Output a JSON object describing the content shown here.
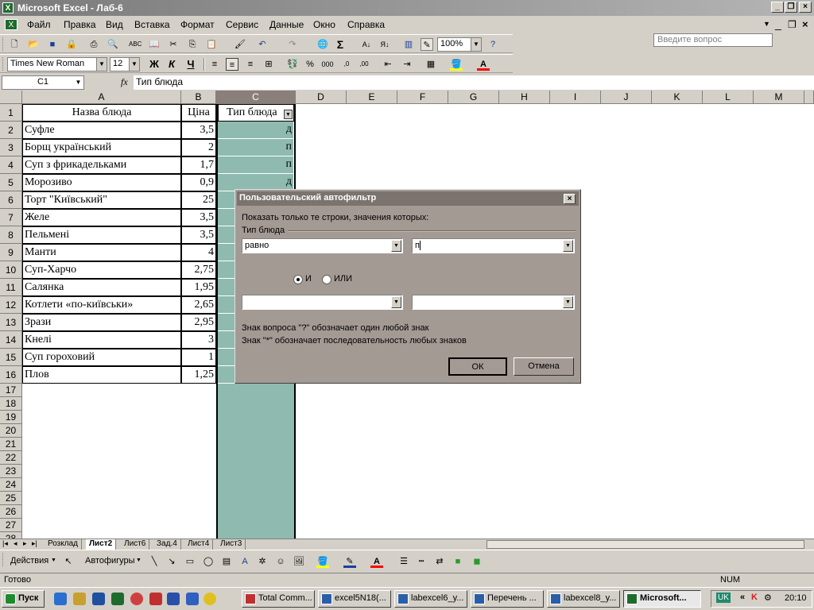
{
  "window": {
    "title": "Microsoft Excel - Лаб-6"
  },
  "menu": {
    "items": [
      "Файл",
      "Правка",
      "Вид",
      "Вставка",
      "Формат",
      "Сервис",
      "Данные",
      "Окно",
      "Справка"
    ],
    "ask_placeholder": "Введите вопрос"
  },
  "toolbar": {
    "zoom": "100%",
    "font": "Times New Roman",
    "font_size": "12",
    "bold": "Ж",
    "italic": "К",
    "underline": "Ч"
  },
  "formula": {
    "namebox": "C1",
    "fx": "fx",
    "content": "Тип блюда"
  },
  "grid": {
    "columns": [
      "A",
      "B",
      "C",
      "D",
      "E",
      "F",
      "G",
      "H",
      "I",
      "J",
      "K",
      "L",
      "M"
    ],
    "header_row": {
      "a": "Назва блюда",
      "b": "Ціна",
      "c": "Тип блюда"
    },
    "rows": [
      {
        "n": "2",
        "a": "Суфле",
        "b": "3,5",
        "c": "д"
      },
      {
        "n": "3",
        "a": "Борщ український",
        "b": "2",
        "c": "п"
      },
      {
        "n": "4",
        "a": "Суп з фрикадельками",
        "b": "1,7",
        "c": "п"
      },
      {
        "n": "5",
        "a": "Морозиво",
        "b": "0,9",
        "c": "д"
      },
      {
        "n": "6",
        "a": "Торт \"Київський\"",
        "b": "25",
        "c": ""
      },
      {
        "n": "7",
        "a": "Желе",
        "b": "3,5",
        "c": ""
      },
      {
        "n": "8",
        "a": "Пельмені",
        "b": "3,5",
        "c": ""
      },
      {
        "n": "9",
        "a": "Манти",
        "b": "4",
        "c": ""
      },
      {
        "n": "10",
        "a": "Суп-Харчо",
        "b": "2,75",
        "c": ""
      },
      {
        "n": "11",
        "a": "Салянка",
        "b": "1,95",
        "c": ""
      },
      {
        "n": "12",
        "a": "Котлети «по-київськи»",
        "b": "2,65",
        "c": ""
      },
      {
        "n": "13",
        "a": "Зрази",
        "b": "2,95",
        "c": ""
      },
      {
        "n": "14",
        "a": "Кнелі",
        "b": "3",
        "c": ""
      },
      {
        "n": "15",
        "a": "Суп гороховий",
        "b": "1",
        "c": ""
      },
      {
        "n": "16",
        "a": "Плов",
        "b": "1,25",
        "c": ""
      }
    ],
    "empty_rows": [
      "17",
      "18",
      "19",
      "20",
      "21",
      "22",
      "23",
      "24",
      "25",
      "26",
      "27",
      "28"
    ]
  },
  "dialog": {
    "title": "Пользовательский автофильтр",
    "prompt": "Показать только те строки, значения которых:",
    "group_label": "Тип блюда",
    "op1": "равно",
    "val1": "п",
    "radio_and": "И",
    "radio_or": "ИЛИ",
    "hint1": "Знак вопроса \"?\" обозначает один любой знак",
    "hint2": "Знак \"*\" обозначает последовательность любых знаков",
    "ok": "ОК",
    "cancel": "Отмена"
  },
  "sheets": [
    "Розклад",
    "Лист2",
    "Лист6",
    "Зад.4",
    "Лист4",
    "Лист3"
  ],
  "drawing": {
    "actions": "Действия",
    "autoshapes": "Автофигуры"
  },
  "status": {
    "ready": "Готово",
    "num": "NUM"
  },
  "taskbar": {
    "start": "Пуск",
    "buttons": [
      "Total Comm...",
      "excel5N18(...",
      "labexcel6_y...",
      "Перечень ...",
      "labexcel8_y...",
      "Microsoft..."
    ],
    "lang": "UK",
    "time": "20:10"
  }
}
